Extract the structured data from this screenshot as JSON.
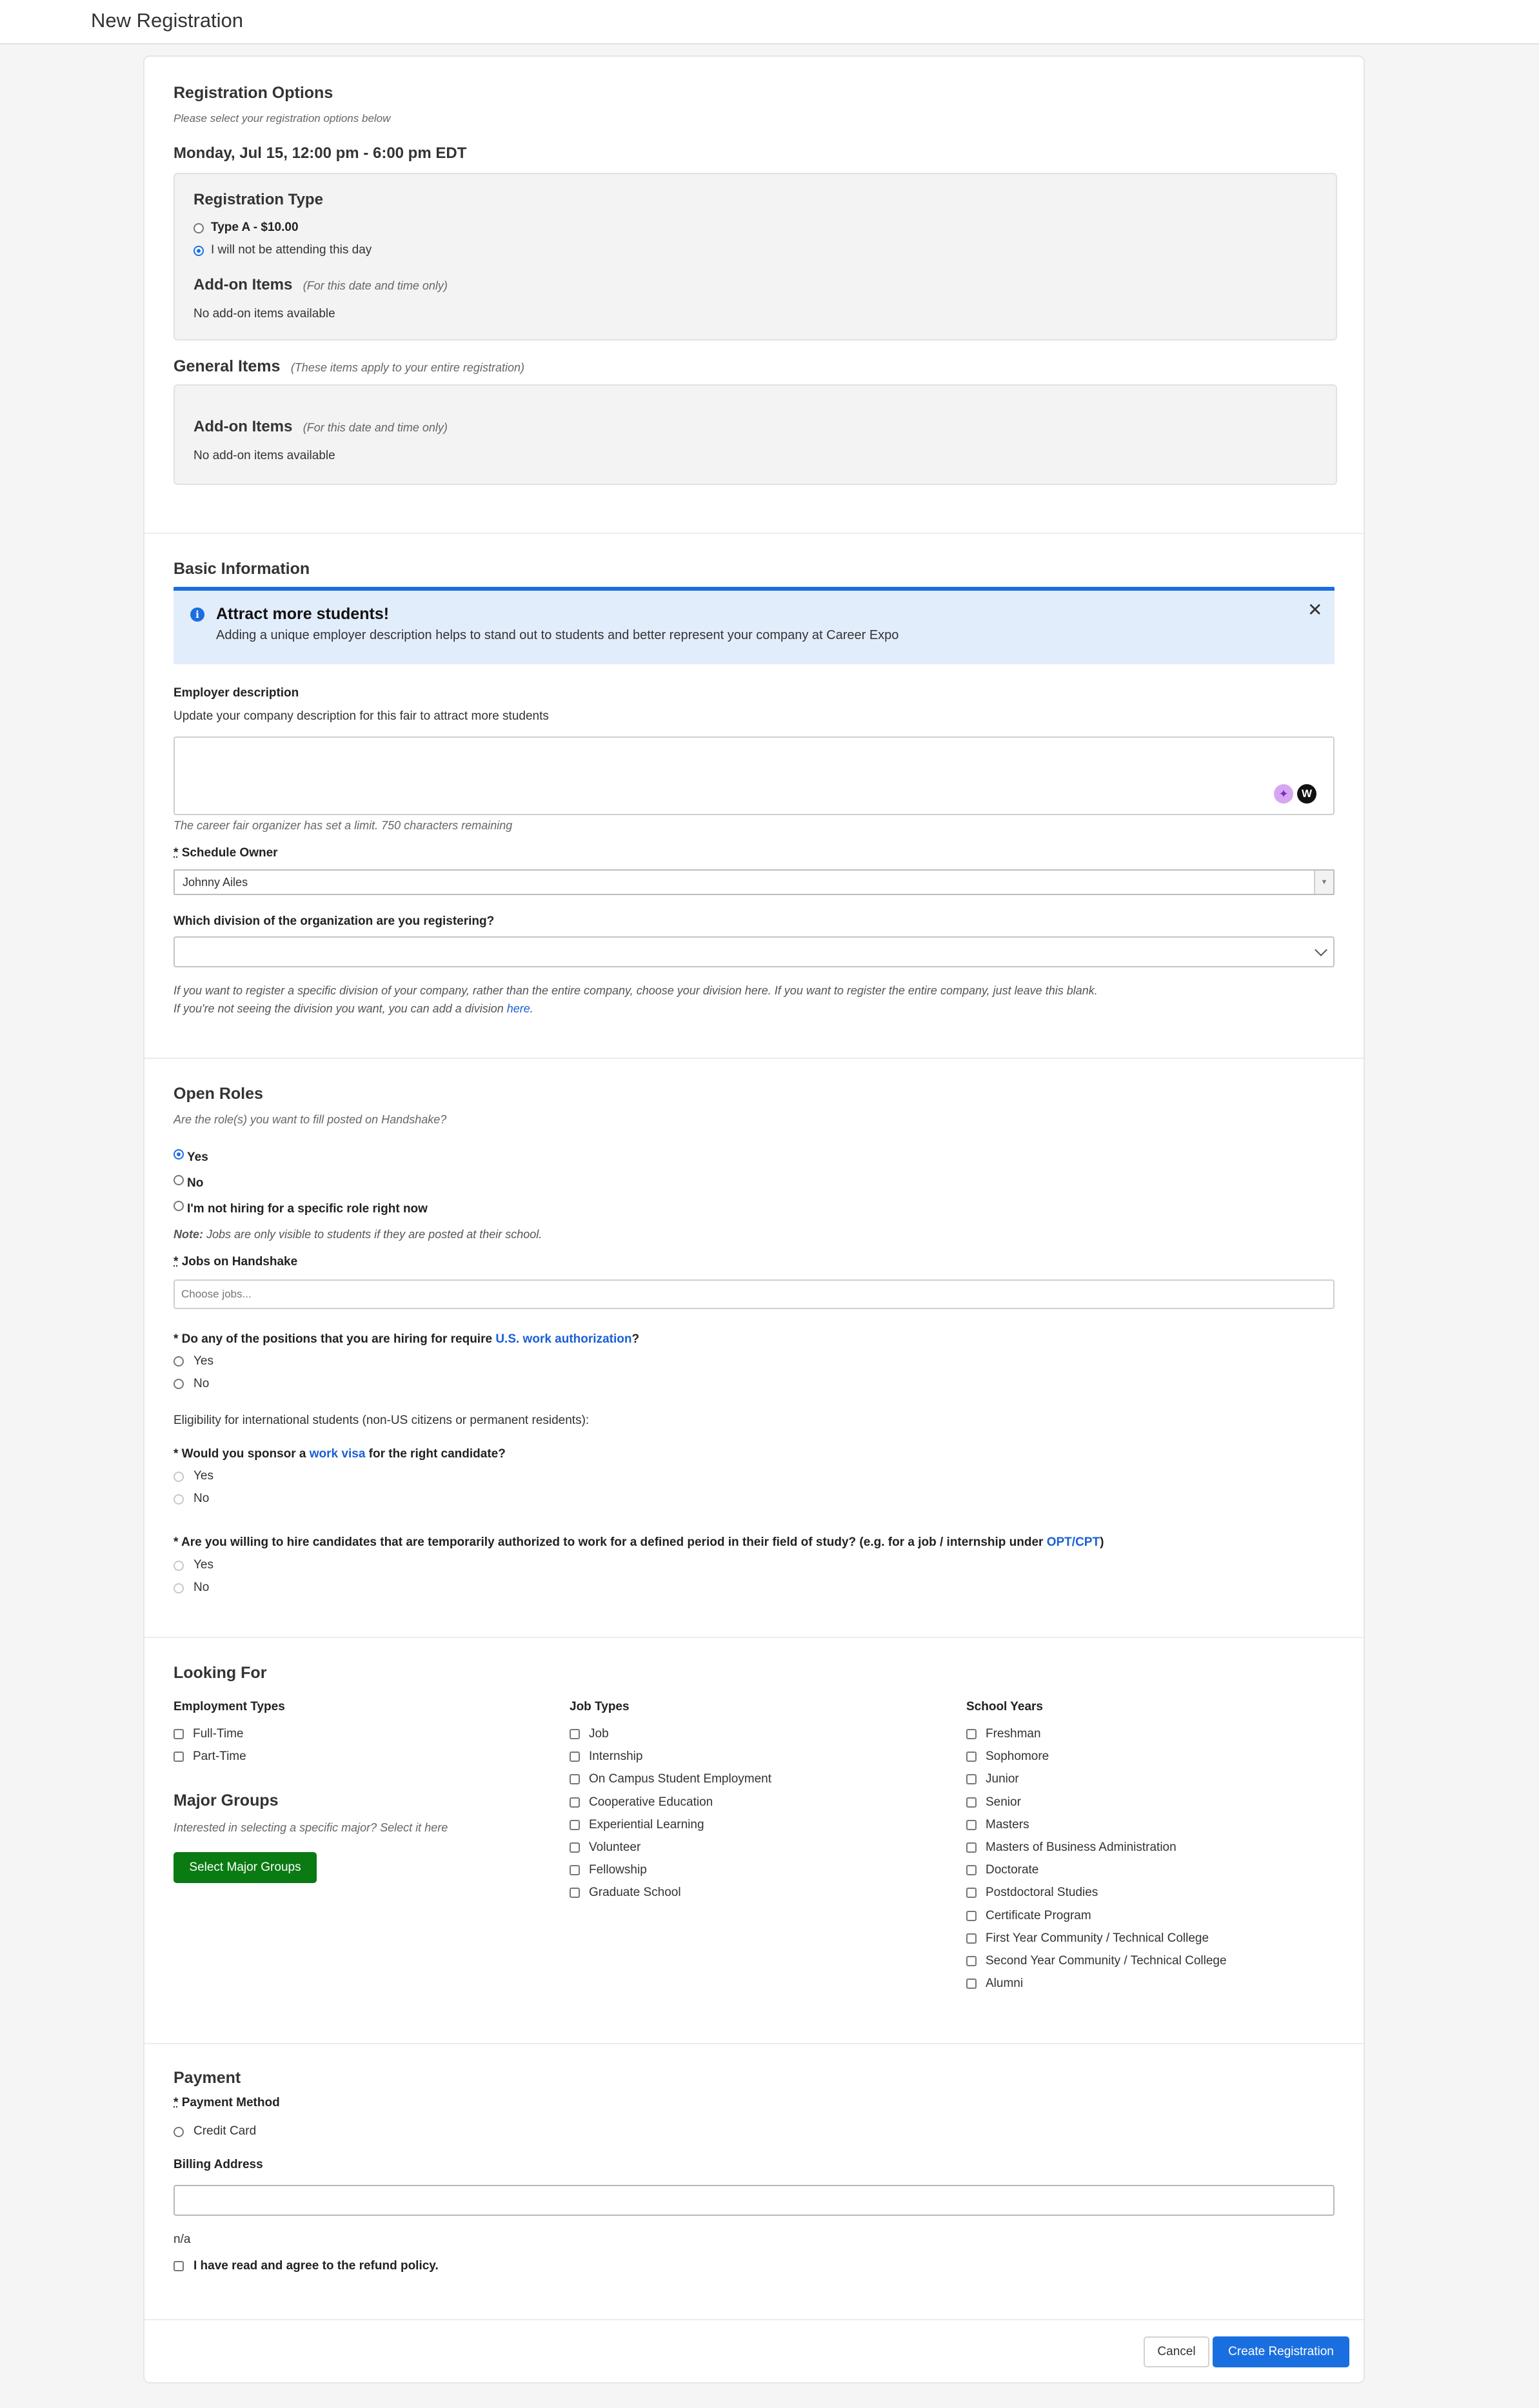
{
  "page": {
    "title": "New Registration"
  },
  "registration_options": {
    "title": "Registration Options",
    "subtitle": "Please select your registration options below",
    "date_time": "Monday, Jul 15, 12:00 pm - 6:00 pm EDT",
    "registration_type": {
      "title": "Registration Type",
      "options": [
        {
          "label": "Type A - $10.00",
          "selected": false
        },
        {
          "label": "I will not be attending this day",
          "selected": true
        }
      ]
    },
    "addon": {
      "title": "Add-on Items",
      "note": "(For this date and time only)",
      "empty": "No add-on items available"
    }
  },
  "general_items": {
    "title": "General Items",
    "note": "(These items apply to your entire registration)",
    "addon": {
      "title": "Add-on Items",
      "note": "(For this date and time only)",
      "empty": "No add-on items available"
    }
  },
  "basic_info": {
    "title": "Basic Information",
    "alert": {
      "title": "Attract more students!",
      "body": "Adding a unique employer description helps to stand out to students and better represent your company at Career Expo",
      "icon": "info-icon"
    },
    "employer_description": {
      "label": "Employer description",
      "help": "Update your company description for this fair to attract more students",
      "value": "",
      "limit_note": "The career fair organizer has set a limit. 750 characters remaining"
    },
    "schedule_owner": {
      "asterisk": "*",
      "label": "Schedule Owner",
      "value": "Johnny Ailes"
    },
    "division": {
      "label": "Which division of the organization are you registering?",
      "value": "",
      "help1": "If you want to register a specific division of your company, rather than the entire company, choose your division here. If you want to register the entire company, just leave this blank.",
      "help2_prefix": "If you're not seeing the division you want, you can add a division ",
      "help2_link": "here",
      "help2_suffix": "."
    }
  },
  "open_roles": {
    "title": "Open Roles",
    "question": "Are the role(s) you want to fill posted on Handshake?",
    "options": [
      {
        "label": "Yes",
        "selected": true
      },
      {
        "label": "No",
        "selected": false
      },
      {
        "label": "I'm not hiring for a specific role right now",
        "selected": false
      }
    ],
    "note_bold": "Note:",
    "note_text": " Jobs are only visible to students if they are posted at their school.",
    "jobs": {
      "asterisk": "*",
      "label": "Jobs on Handshake",
      "placeholder": "Choose jobs..."
    },
    "work_auth": {
      "prefix": "* Do any of the positions that you are hiring for require ",
      "link": "U.S. work authorization",
      "suffix": "?",
      "yes": "Yes",
      "no": "No"
    },
    "eligibility": "Eligibility for international students (non-US citizens or permanent residents):",
    "visa": {
      "prefix": "* Would you sponsor a ",
      "link": "work visa",
      "suffix": " for the right candidate?",
      "yes": "Yes",
      "no": "No"
    },
    "opt": {
      "prefix": "* Are you willing to hire candidates that are temporarily authorized to work for a defined period in their field of study? (e.g. for a job / internship under ",
      "link": "OPT/CPT",
      "suffix": ")",
      "yes": "Yes",
      "no": "No"
    }
  },
  "looking_for": {
    "title": "Looking For",
    "employment_types": {
      "title": "Employment Types",
      "items": [
        "Full-Time",
        "Part-Time"
      ]
    },
    "job_types": {
      "title": "Job Types",
      "items": [
        "Job",
        "Internship",
        "On Campus Student Employment",
        "Cooperative Education",
        "Experiential Learning",
        "Volunteer",
        "Fellowship",
        "Graduate School"
      ]
    },
    "school_years": {
      "title": "School Years",
      "items": [
        "Freshman",
        "Sophomore",
        "Junior",
        "Senior",
        "Masters",
        "Masters of Business Administration",
        "Doctorate",
        "Postdoctoral Studies",
        "Certificate Program",
        "First Year Community / Technical College",
        "Second Year Community / Technical College",
        "Alumni"
      ]
    },
    "major_groups": {
      "title": "Major Groups",
      "help": "Interested in selecting a specific major? Select it here",
      "button": "Select Major Groups"
    }
  },
  "payment": {
    "title": "Payment",
    "method": {
      "asterisk": "*",
      "label": "Payment Method",
      "option": "Credit Card"
    },
    "billing": {
      "label": "Billing Address",
      "value": "",
      "below": "n/a"
    },
    "refund": "I have read and agree to the refund policy."
  },
  "footer": {
    "cancel": "Cancel",
    "create": "Create Registration"
  },
  "colors": {
    "accent": "#1a6fe0",
    "green": "#0a7a12"
  }
}
